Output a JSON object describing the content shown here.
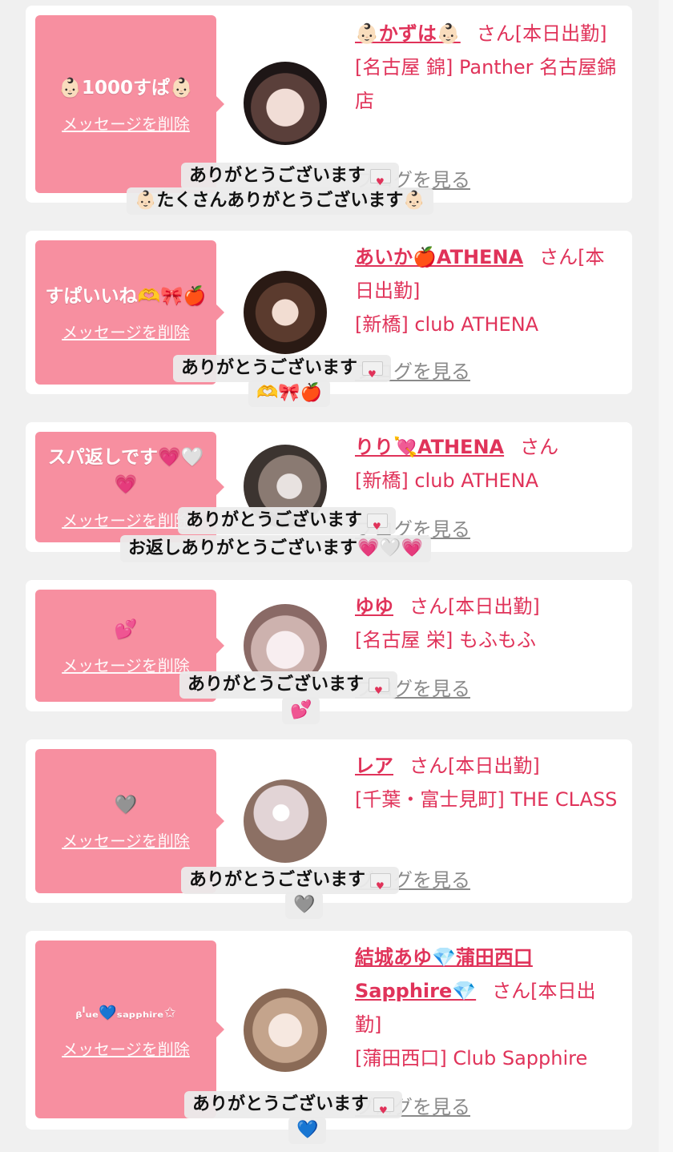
{
  "cards": [
    {
      "message": "👶🏻1000すぱ👶🏻",
      "delete": "メッセージを削除",
      "name": "👶🏻かずは👶🏻",
      "suffix": "さん[本日出勤]",
      "shop": "[名古屋 錦] Panther 名古屋錦店",
      "blog": "ブログを見る",
      "overlay1": "ありがとうございます",
      "overlay2": "👶🏻たくさんありがとうございます👶🏻",
      "avatar_colors": [
        "#d8c0b4",
        "#2a1e1e"
      ]
    },
    {
      "message": "すぱいいね🫶🎀🍎",
      "delete": "メッセージを削除",
      "name": "あいか🍎ATHENA",
      "suffix": "さん[本日出勤]",
      "shop": "[新橋] club ATHENA",
      "blog": "ブログを見る",
      "overlay1": "ありがとうございます",
      "overlay2": "🫶🎀🍎",
      "avatar_colors": [
        "#6a4434",
        "#2a1a14"
      ]
    },
    {
      "message": "スパ返しです💗🤍💗",
      "delete": "メッセージを削除",
      "name": "りり💘ATHENA",
      "suffix": "さん",
      "shop": "[新橋] club ATHENA",
      "blog": "ブログを見る",
      "overlay1": "ありがとうございます",
      "overlay2": "お返しありがとうございます💗🤍💗",
      "avatar_colors": [
        "#9b8a80",
        "#3c3430"
      ]
    },
    {
      "message": "💕",
      "delete": "メッセージを削除",
      "name": "ゆゆ",
      "suffix": "さん[本日出勤]",
      "shop": "[名古屋 栄] もふもふ",
      "blog": "ブログを見る",
      "overlay1": "ありがとうございます",
      "overlay2": "💕",
      "avatar_colors": [
        "#f0e4e6",
        "#b0928e"
      ]
    },
    {
      "message": "🩶",
      "delete": "メッセージを削除",
      "name": "レア",
      "suffix": "さん[本日出勤]",
      "shop": "[千葉・富士見町] THE CLASS",
      "blog": "ブログを見る",
      "overlay1": "ありがとうございます",
      "overlay2": "🩶",
      "avatar_colors": [
        "#d4c8cc",
        "#8c7064"
      ]
    },
    {
      "message": "ᵦˡᵤₑ💙ₛₐₚₚₕᵢᵣₑ✩",
      "delete": "メッセージを削除",
      "name": "結城あゆ💎蒲田西口Sapphire💎",
      "suffix": "さん[本日出勤]",
      "shop": "[蒲田西口] Club Sapphire",
      "blog": "ブログを見る",
      "overlay1": "ありがとうございます",
      "overlay2": "💙",
      "avatar_colors": [
        "#e4d0c4",
        "#a2836e"
      ]
    }
  ]
}
